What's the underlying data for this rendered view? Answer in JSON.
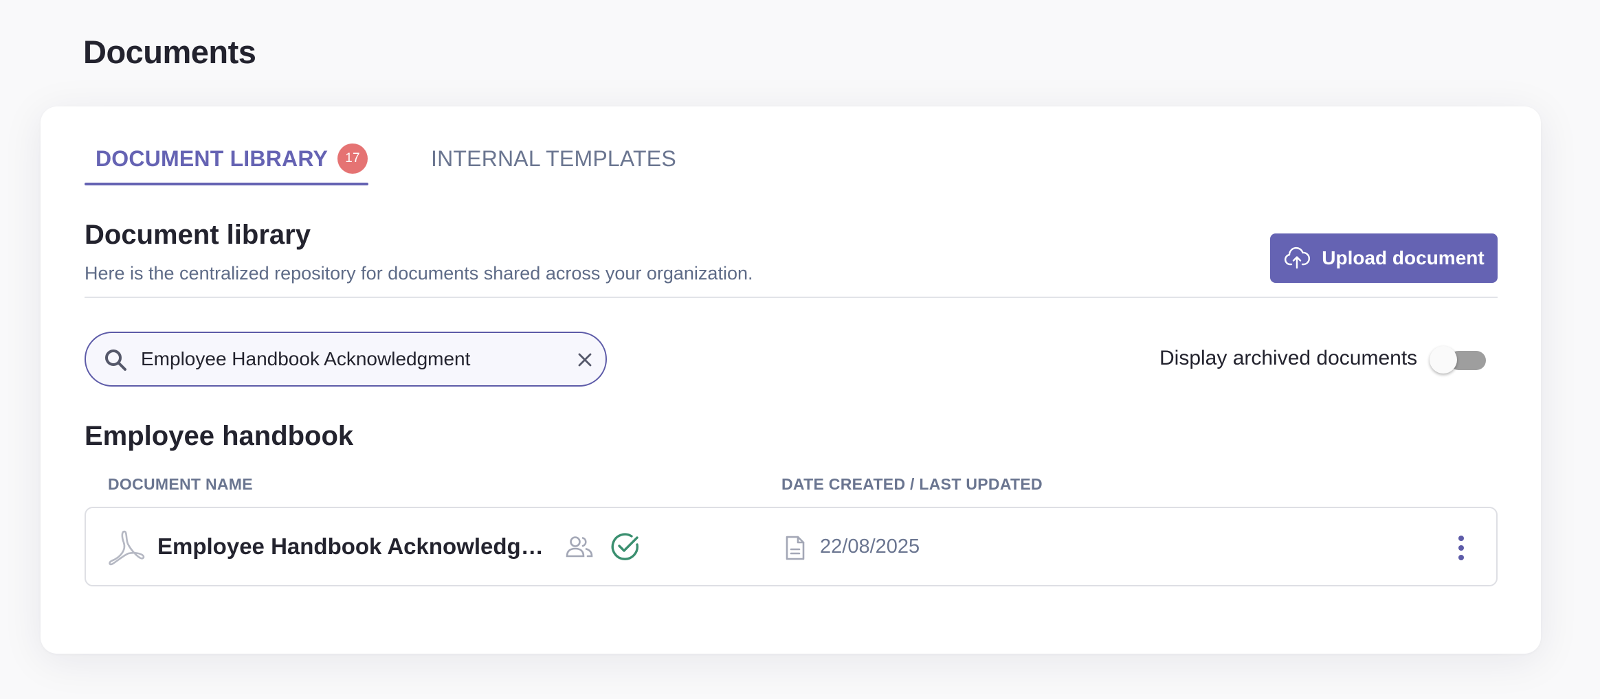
{
  "page": {
    "title": "Documents"
  },
  "tabs": [
    {
      "label": "DOCUMENT LIBRARY",
      "badge": "17",
      "active": true
    },
    {
      "label": "INTERNAL TEMPLATES",
      "active": false
    }
  ],
  "section": {
    "title": "Document library",
    "description": "Here is the centralized repository for documents shared across your organization."
  },
  "upload_button": {
    "label": "Upload document",
    "icon": "cloud-upload-icon"
  },
  "search": {
    "value": "Employee Handbook Acknowledgment",
    "icon": "search-icon",
    "clear_icon": "close-icon"
  },
  "archived_toggle": {
    "label": "Display archived documents",
    "enabled": false
  },
  "group": {
    "title": "Employee handbook",
    "columns": {
      "name": "DOCUMENT NAME",
      "date": "DATE CREATED / LAST UPDATED"
    },
    "documents": [
      {
        "name": "Employee Handbook Acknowledgment...",
        "type_icon": "pdf-icon",
        "shared_icon": "people-icon",
        "status_icon": "check-circle-icon",
        "date_icon": "file-icon",
        "date": "22/08/2025",
        "menu_icon": "more-vertical-icon"
      }
    ]
  },
  "colors": {
    "accent": "#6563b3",
    "badge": "#e57373",
    "success": "#3a8f6f",
    "muted_text": "#6a7590"
  }
}
